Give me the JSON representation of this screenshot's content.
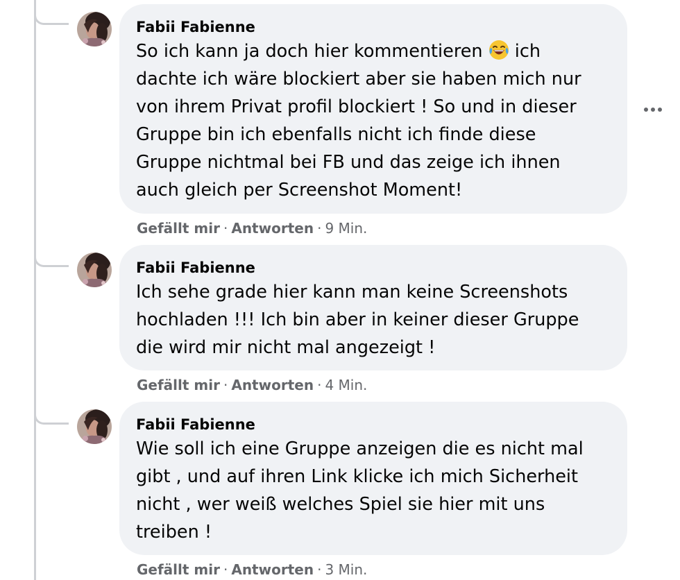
{
  "comments": [
    {
      "author": "Fabii Fabienne",
      "lines": [
        {
          "text": "So ich kann ja doch hier kommentieren",
          "emoji_after": "laughing-tears-emoji",
          "tail": " ich"
        },
        {
          "text": "dachte ich wäre blockiert aber sie haben mich nur"
        },
        {
          "text": "von ihrem Privat profil blockiert ! So und in dieser"
        },
        {
          "text": "Gruppe bin ich ebenfalls nicht ich finde diese"
        },
        {
          "text": "Gruppe nichtmal bei FB und das zeige ich ihnen"
        },
        {
          "text": "auch gleich per Screenshot Moment!"
        }
      ],
      "like_label": "Gefällt mir",
      "reply_label": "Antworten",
      "time": "9 Min."
    },
    {
      "author": "Fabii Fabienne",
      "lines": [
        {
          "text": "Ich sehe grade hier kann man keine Screenshots"
        },
        {
          "text": "hochladen !!! Ich bin aber in keiner dieser Gruppe"
        },
        {
          "text": "die wird mir nicht mal angezeigt !"
        }
      ],
      "like_label": "Gefällt mir",
      "reply_label": "Antworten",
      "time": "4 Min."
    },
    {
      "author": "Fabii Fabienne",
      "lines": [
        {
          "text": "Wie soll ich eine Gruppe anzeigen die es nicht mal"
        },
        {
          "text": "gibt , und auf ihren Link klicke ich mich Sicherheit"
        },
        {
          "text": "nicht , wer weiß welches Spiel sie hier mit uns"
        },
        {
          "text": "treiben !"
        }
      ],
      "like_label": "Gefällt mir",
      "reply_label": "Antworten",
      "time": "3 Min."
    }
  ],
  "separator": "·",
  "icons": {
    "more": "more-options-icon",
    "emoji": "laughing-tears-emoji"
  },
  "colors": {
    "bubble": "#f0f2f5",
    "text": "#050505",
    "secondary": "#65676b",
    "thread_line": "#ced0d4"
  }
}
